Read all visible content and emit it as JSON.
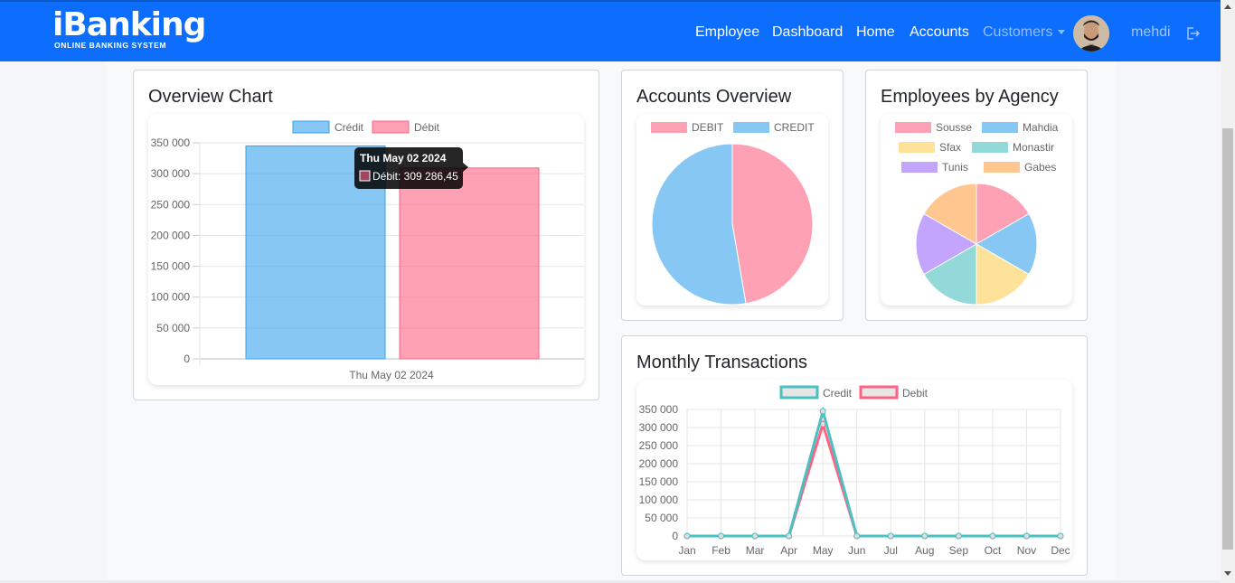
{
  "brand": {
    "name": "iBanking",
    "subtitle": "ONLINE BANKING SYSTEM"
  },
  "nav": {
    "items": [
      "Employee",
      "Dashboard",
      "Home",
      "Accounts",
      "Customers"
    ],
    "user": "mehdi"
  },
  "colors": {
    "navbar": "#0d6efd",
    "credit": "#36a2eb",
    "debit": "#ff6384",
    "credit_line": "#4bc0c0"
  },
  "icons": {
    "logout": "logout-icon",
    "dropdown": "chevron-down-icon"
  },
  "overview": {
    "title": "Overview Chart",
    "tooltip": {
      "title": "Thu May 02 2024",
      "line": "Débit: 309 286,45"
    }
  },
  "accounts": {
    "title": "Accounts Overview"
  },
  "employees": {
    "title": "Employees by Agency"
  },
  "monthly": {
    "title": "Monthly Transactions"
  },
  "chart_data": [
    {
      "type": "bar",
      "title": "",
      "categories": [
        "Thu May 02 2024"
      ],
      "series": [
        {
          "name": "Crédit",
          "values": [
            345000
          ]
        },
        {
          "name": "Débit",
          "values": [
            309286.45
          ]
        }
      ],
      "yticks": [
        "350 000",
        "300 000",
        "250 000",
        "200 000",
        "150 000",
        "100 000",
        "50 000",
        "0"
      ],
      "ylim": [
        0,
        350000
      ],
      "legend": "top",
      "grid": true
    },
    {
      "type": "pie",
      "labels": [
        "DEBIT",
        "CREDIT"
      ],
      "values": [
        47.3,
        52.7
      ],
      "legend": "top"
    },
    {
      "type": "pie",
      "labels": [
        "Sousse",
        "Mahdia",
        "Sfax",
        "Monastir",
        "Tunis",
        "Gabes"
      ],
      "values": [
        1,
        1,
        1,
        1,
        1,
        1
      ],
      "legend": "top"
    },
    {
      "type": "line",
      "x": [
        "Jan",
        "Feb",
        "Mar",
        "Apr",
        "May",
        "Jun",
        "Jul",
        "Aug",
        "Sep",
        "Oct",
        "Nov",
        "Dec"
      ],
      "series": [
        {
          "name": "Credit",
          "values": [
            0,
            0,
            0,
            0,
            345000,
            0,
            0,
            0,
            0,
            0,
            0,
            0
          ]
        },
        {
          "name": "Debit",
          "values": [
            0,
            0,
            0,
            0,
            309286.45,
            0,
            0,
            0,
            0,
            0,
            0,
            0
          ]
        }
      ],
      "yticks": [
        "350 000",
        "300 000",
        "250 000",
        "200 000",
        "150 000",
        "100 000",
        "50 000",
        "0"
      ],
      "ylim": [
        0,
        350000
      ],
      "legend": "top",
      "grid": true
    }
  ]
}
